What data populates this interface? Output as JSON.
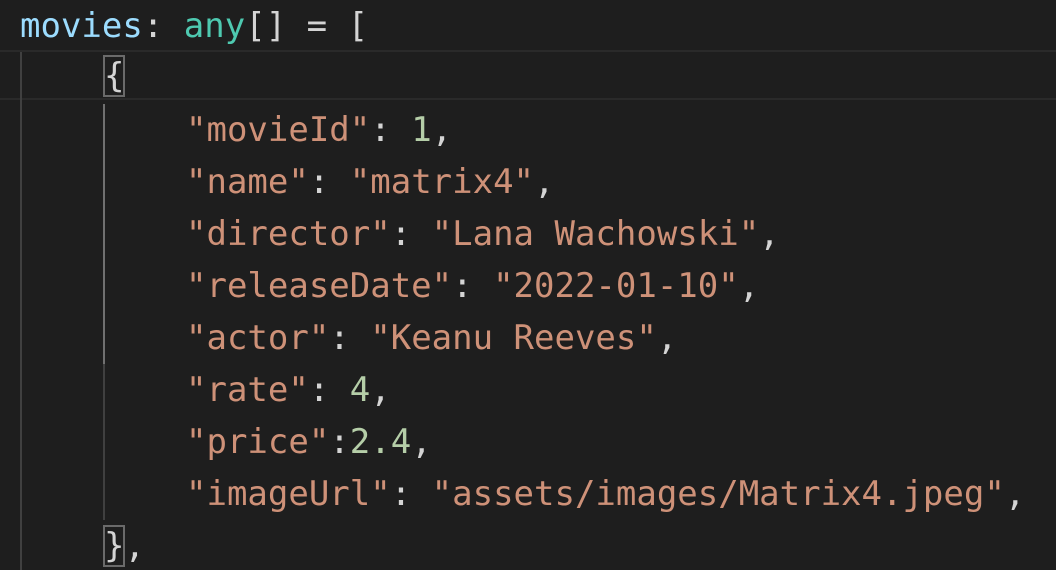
{
  "declaration": {
    "name": "movies",
    "colon": ":",
    "type": "any",
    "brackets": "[]",
    "equals": "=",
    "open": "["
  },
  "object_open": "{",
  "object_close": "},",
  "fields": [
    {
      "key": "\"movieId\"",
      "sep": ": ",
      "value": "1",
      "value_kind": "num",
      "tail": ","
    },
    {
      "key": "\"name\"",
      "sep": ": ",
      "value": "\"matrix4\"",
      "value_kind": "str",
      "tail": ","
    },
    {
      "key": "\"director\"",
      "sep": ": ",
      "value": "\"Lana Wachowski\"",
      "value_kind": "str",
      "tail": ","
    },
    {
      "key": "\"releaseDate\"",
      "sep": ": ",
      "value": "\"2022-01-10\"",
      "value_kind": "str",
      "tail": ","
    },
    {
      "key": "\"actor\"",
      "sep": ": ",
      "value": "\"Keanu Reeves\"",
      "value_kind": "str",
      "tail": ","
    },
    {
      "key": "\"rate\"",
      "sep": ": ",
      "value": "4",
      "value_kind": "num",
      "tail": ","
    },
    {
      "key": "\"price\"",
      "sep": ":",
      "value": "2.4",
      "value_kind": "num",
      "tail": ","
    },
    {
      "key": "\"imageUrl\"",
      "sep": ": ",
      "value": "\"assets/images/Matrix4.jpeg\"",
      "value_kind": "str",
      "tail": ","
    }
  ],
  "colors": {
    "background": "#1e1e1e",
    "variable": "#9cdcfe",
    "type": "#4ec9b0",
    "string": "#ce9178",
    "number": "#b5cea8",
    "punctuation": "#d4d4d4"
  }
}
